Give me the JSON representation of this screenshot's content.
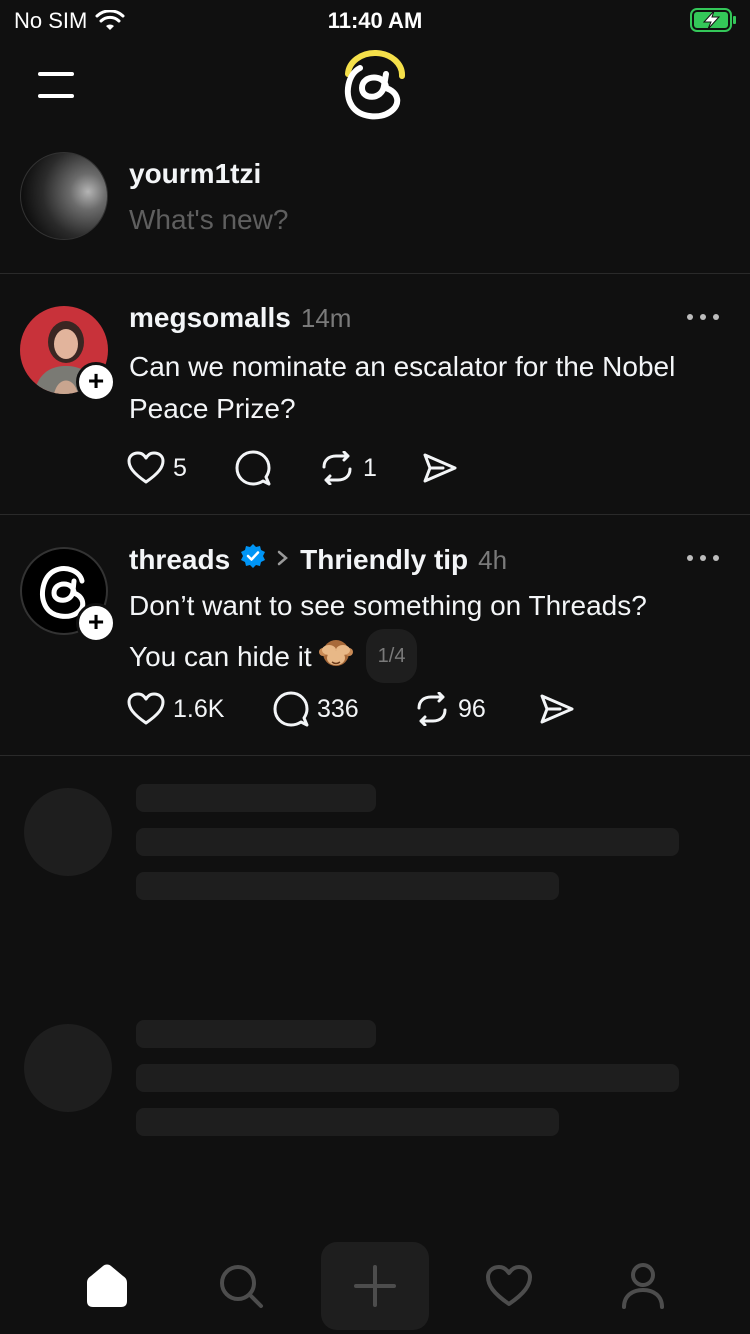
{
  "status_bar": {
    "carrier": "No SIM",
    "time": "11:40 AM"
  },
  "composer": {
    "username": "yourm1tzi",
    "placeholder": "What's new?"
  },
  "posts": [
    {
      "username": "megsomalls",
      "time": "14m",
      "text": "Can we nominate an escalator for the Nobel Peace Prize?",
      "likes": "5",
      "replies": "",
      "reposts": "1"
    },
    {
      "username": "threads",
      "verified": true,
      "topic": "Thriendly tip",
      "time": "4h",
      "text_line1": "Don’t want to see something on Threads?",
      "text_line2": "You can hide it",
      "pager": "1/4",
      "likes": "1.6K",
      "replies": "336",
      "reposts": "96"
    }
  ],
  "colors": {
    "background": "#101010",
    "verified": "#0095f6",
    "logo_accent": "#f5e04a",
    "battery": "#34c759"
  },
  "tabs": [
    "home",
    "search",
    "create",
    "activity",
    "profile"
  ]
}
